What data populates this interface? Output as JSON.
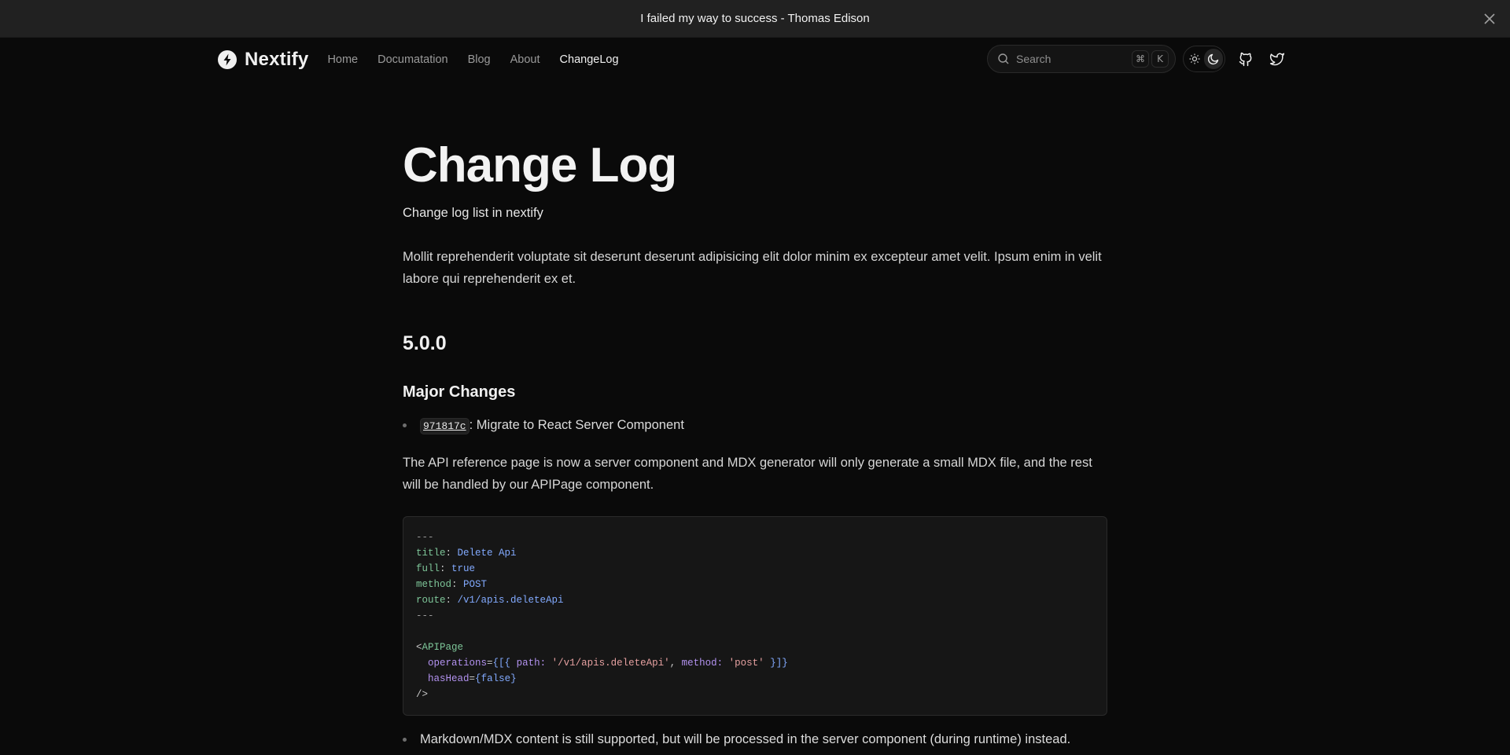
{
  "banner": {
    "text": "I failed my way to success - Thomas Edison",
    "close_icon": "close-icon"
  },
  "nav": {
    "brand": "Nextify",
    "logo_icon": "lightning-bolt-icon",
    "links": [
      {
        "label": "Home",
        "active": false
      },
      {
        "label": "Documatation",
        "active": false
      },
      {
        "label": "Blog",
        "active": false
      },
      {
        "label": "About",
        "active": false
      },
      {
        "label": "ChangeLog",
        "active": true
      }
    ],
    "search": {
      "placeholder": "Search",
      "shortcut_mod": "⌘",
      "shortcut_key": "K"
    },
    "theme": {
      "light_icon": "sun-icon",
      "dark_icon": "moon-icon",
      "selected": "dark"
    },
    "github_icon": "github-icon",
    "twitter_icon": "twitter-icon"
  },
  "page": {
    "title": "Change Log",
    "description": "Change log list in nextify",
    "intro": "Mollit reprehenderit voluptate sit deserunt deserunt adipisicing elit dolor minim ex excepteur amet velit. Ipsum enim in velit labore qui reprehenderit ex et.",
    "version": "5.0.0",
    "section": "Major Changes",
    "changes": [
      {
        "commit": "971817c",
        "text": ": Migrate to React Server Component"
      }
    ],
    "explanation": "The API reference page is now a server component and MDX generator will only generate a small MDX file, and the rest will be handled by our APIPage component.",
    "code": {
      "frontmatter_delim": "---",
      "fields": [
        {
          "key": "title",
          "value": "Delete Api"
        },
        {
          "key": "full",
          "value": "true"
        },
        {
          "key": "method",
          "value": "POST"
        },
        {
          "key": "route",
          "value": "/v1/apis.deleteApi"
        }
      ],
      "component": "APIPage",
      "ops_attr": "operations",
      "ops_path_key": "path:",
      "ops_path_val": "'/v1/apis.deleteApi'",
      "ops_method_key": "method:",
      "ops_method_val": "'post'",
      "has_head_attr": "hasHead",
      "has_head_val": "false"
    },
    "notes": [
      "Markdown/MDX content is still supported, but will be processed in the server component (during runtime) instead."
    ]
  }
}
